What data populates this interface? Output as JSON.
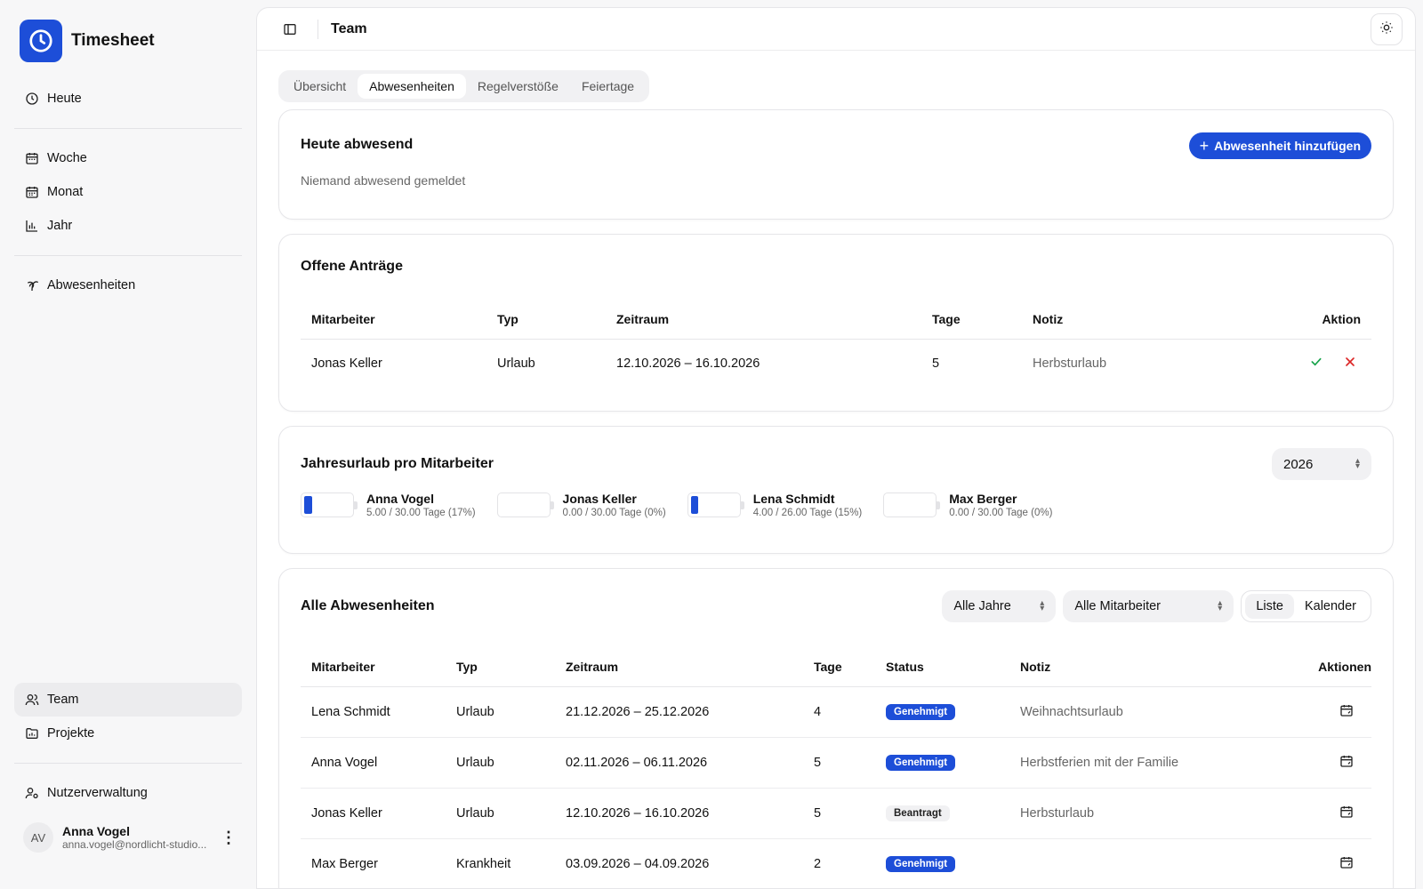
{
  "app": {
    "name": "Timesheet"
  },
  "sidebar": {
    "groups": [
      [
        {
          "label": "Heute",
          "icon": "clock-icon"
        }
      ],
      [
        {
          "label": "Woche",
          "icon": "calendar-week-icon"
        },
        {
          "label": "Monat",
          "icon": "calendar-month-icon"
        },
        {
          "label": "Jahr",
          "icon": "bar-chart-icon"
        }
      ],
      [
        {
          "label": "Abwesenheiten",
          "icon": "palm-tree-icon"
        }
      ]
    ],
    "bottom": [
      {
        "label": "Team",
        "icon": "users-icon",
        "active": true
      },
      {
        "label": "Projekte",
        "icon": "folder-icon"
      }
    ],
    "admin": {
      "label": "Nutzerverwaltung",
      "icon": "user-cog-icon"
    },
    "user": {
      "initials": "AV",
      "name": "Anna Vogel",
      "email": "anna.vogel@nordlicht-studio..."
    }
  },
  "header": {
    "title": "Team"
  },
  "tabs": [
    {
      "label": "Übersicht",
      "active": false
    },
    {
      "label": "Abwesenheiten",
      "active": true
    },
    {
      "label": "Regelverstöße",
      "active": false
    },
    {
      "label": "Feiertage",
      "active": false
    }
  ],
  "today": {
    "title": "Heute abwesend",
    "empty": "Niemand abwesend gemeldet",
    "add_button": "Abwesenheit hinzufügen"
  },
  "requests": {
    "title": "Offene Anträge",
    "columns": [
      "Mitarbeiter",
      "Typ",
      "Zeitraum",
      "Tage",
      "Notiz",
      "Aktion"
    ],
    "rows": [
      {
        "employee": "Jonas Keller",
        "type": "Urlaub",
        "period": "12.10.2026 – 16.10.2026",
        "days": "5",
        "note": "Herbsturlaub"
      }
    ]
  },
  "quota": {
    "title": "Jahresurlaub pro Mitarbeiter",
    "year": "2026",
    "items": [
      {
        "name": "Anna Vogel",
        "detail": "5.00 / 30.00 Tage (17%)",
        "fraction": 0.17
      },
      {
        "name": "Jonas Keller",
        "detail": "0.00 / 30.00 Tage (0%)",
        "fraction": 0
      },
      {
        "name": "Lena Schmidt",
        "detail": "4.00 / 26.00 Tage (15%)",
        "fraction": 0.15
      },
      {
        "name": "Max Berger",
        "detail": "0.00 / 30.00 Tage (0%)",
        "fraction": 0
      }
    ]
  },
  "all": {
    "title": "Alle Abwesenheiten",
    "year_filter": "Alle Jahre",
    "employee_filter": "Alle Mitarbeiter",
    "view_list": "Liste",
    "view_calendar": "Kalender",
    "columns": [
      "Mitarbeiter",
      "Typ",
      "Zeitraum",
      "Tage",
      "Status",
      "Notiz",
      "Aktionen"
    ],
    "rows": [
      {
        "employee": "Lena Schmidt",
        "type": "Urlaub",
        "period": "21.12.2026 – 25.12.2026",
        "days": "4",
        "status": "Genehmigt",
        "approved": true,
        "note": "Weihnachtsurlaub"
      },
      {
        "employee": "Anna Vogel",
        "type": "Urlaub",
        "period": "02.11.2026 – 06.11.2026",
        "days": "5",
        "status": "Genehmigt",
        "approved": true,
        "note": "Herbstferien mit der Familie"
      },
      {
        "employee": "Jonas Keller",
        "type": "Urlaub",
        "period": "12.10.2026 – 16.10.2026",
        "days": "5",
        "status": "Beantragt",
        "approved": false,
        "note": "Herbsturlaub"
      },
      {
        "employee": "Max Berger",
        "type": "Krankheit",
        "period": "03.09.2026 – 04.09.2026",
        "days": "2",
        "status": "Genehmigt",
        "approved": true,
        "note": ""
      }
    ]
  },
  "colors": {
    "accent": "#1d4ed8",
    "approve": "#16a34a",
    "reject": "#dc2626"
  }
}
